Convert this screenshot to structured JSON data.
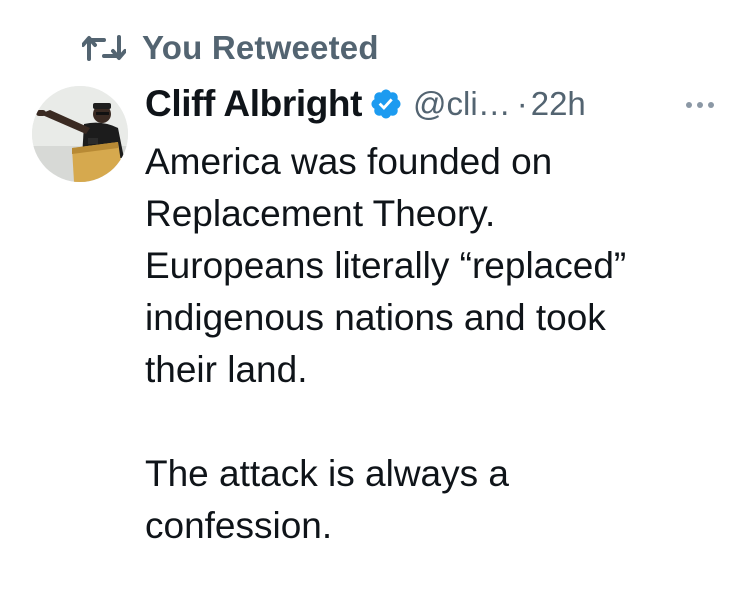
{
  "retweet": {
    "label": "You Retweeted",
    "icon": "retweet-icon"
  },
  "author": {
    "display_name": "Cliff Albright",
    "verified_icon": "verified-badge-icon",
    "handle": "@cli…",
    "separator": "·",
    "timestamp": "22h",
    "avatar": "avatar-photo"
  },
  "more_icon": "more-options-icon",
  "tweet": {
    "lines": [
      "America was founded on",
      "Replacement Theory.",
      "Europeans literally “replaced”",
      "indigenous nations and took",
      "their land."
    ],
    "lines2": [
      "The attack is always a",
      "confession."
    ]
  },
  "colors": {
    "text_primary": "#0f1419",
    "text_secondary": "#536471",
    "verified_blue": "#1d9bf0",
    "background": "#ffffff"
  }
}
